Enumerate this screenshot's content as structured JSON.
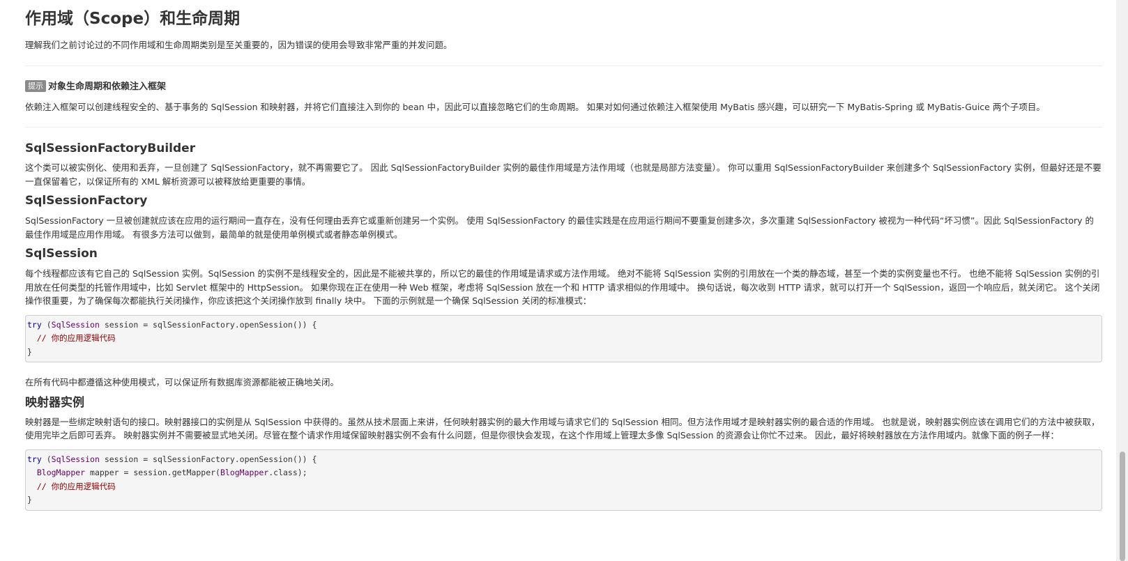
{
  "title": "作用域（Scope）和生命周期",
  "intro": "理解我们之前讨论过的不同作用域和生命周期类别是至关重要的，因为错误的使用会导致非常严重的并发问题。",
  "tip": {
    "badge": "提示",
    "title": "对象生命周期和依赖注入框架",
    "text": "依赖注入框架可以创建线程安全的、基于事务的 SqlSession 和映射器，并将它们直接注入到你的 bean 中，因此可以直接忽略它们的生命周期。 如果对如何通过依赖注入框架使用 MyBatis 感兴趣，可以研究一下 MyBatis-Spring 或 MyBatis-Guice 两个子项目。"
  },
  "sections": {
    "builder": {
      "heading": "SqlSessionFactoryBuilder",
      "text": "这个类可以被实例化、使用和丢弃，一旦创建了 SqlSessionFactory，就不再需要它了。 因此 SqlSessionFactoryBuilder 实例的最佳作用域是方法作用域（也就是局部方法变量）。 你可以重用 SqlSessionFactoryBuilder 来创建多个 SqlSessionFactory 实例，但最好还是不要一直保留着它，以保证所有的 XML 解析资源可以被释放给更重要的事情。"
    },
    "factory": {
      "heading": "SqlSessionFactory",
      "text": "SqlSessionFactory 一旦被创建就应该在应用的运行期间一直存在，没有任何理由丢弃它或重新创建另一个实例。 使用 SqlSessionFactory 的最佳实践是在应用运行期间不要重复创建多次，多次重建 SqlSessionFactory 被视为一种代码“坏习惯”。因此 SqlSessionFactory 的最佳作用域是应用作用域。 有很多方法可以做到，最简单的就是使用单例模式或者静态单例模式。"
    },
    "session": {
      "heading": "SqlSession",
      "text": "每个线程都应该有它自己的 SqlSession 实例。SqlSession 的实例不是线程安全的，因此是不能被共享的，所以它的最佳的作用域是请求或方法作用域。 绝对不能将 SqlSession 实例的引用放在一个类的静态域，甚至一个类的实例变量也不行。 也绝不能将 SqlSession 实例的引用放在任何类型的托管作用域中，比如 Servlet 框架中的 HttpSession。 如果你现在正在使用一种 Web 框架，考虑将 SqlSession 放在一个和 HTTP 请求相似的作用域中。 换句话说，每次收到 HTTP 请求，就可以打开一个 SqlSession，返回一个响应后，就关闭它。 这个关闭操作很重要，为了确保每次都能执行关闭操作，你应该把这个关闭操作放到 finally 块中。 下面的示例就是一个确保 SqlSession 关闭的标准模式：",
      "code": {
        "l1_kw": "try",
        "l1_a": " (",
        "l1_type": "SqlSession",
        "l1_b": " session = sqlSessionFactory.openSession()) {",
        "l2_comment": "  // 你的应用逻辑代码",
        "l3": "}"
      },
      "after": "在所有代码中都遵循这种使用模式，可以保证所有数据库资源都能被正确地关闭。"
    },
    "mapper": {
      "heading": "映射器实例",
      "text": "映射器是一些绑定映射语句的接口。映射器接口的实例是从 SqlSession 中获得的。虽然从技术层面上来讲，任何映射器实例的最大作用域与请求它们的 SqlSession 相同。但方法作用域才是映射器实例的最合适的作用域。 也就是说，映射器实例应该在调用它们的方法中被获取，使用完毕之后即可丢弃。 映射器实例并不需要被显式地关闭。尽管在整个请求作用域保留映射器实例不会有什么问题，但是你很快会发现，在这个作用域上管理太多像 SqlSession 的资源会让你忙不过来。 因此，最好将映射器放在方法作用域内。就像下面的例子一样：",
      "code": {
        "l1_kw": "try",
        "l1_a": " (",
        "l1_type": "SqlSession",
        "l1_b": " session = sqlSessionFactory.openSession()) {",
        "l2_indent": "  ",
        "l2_type": "BlogMapper",
        "l2_a": " mapper = session.getMapper(",
        "l2_type2": "BlogMapper",
        "l2_b": ".class);",
        "l3_comment": "  // 你的应用逻辑代码",
        "l4": "}"
      }
    }
  },
  "colors": {
    "keyword": "#000088",
    "type": "#660066",
    "comment": "#880000",
    "code_bg": "#f5f5f5"
  }
}
